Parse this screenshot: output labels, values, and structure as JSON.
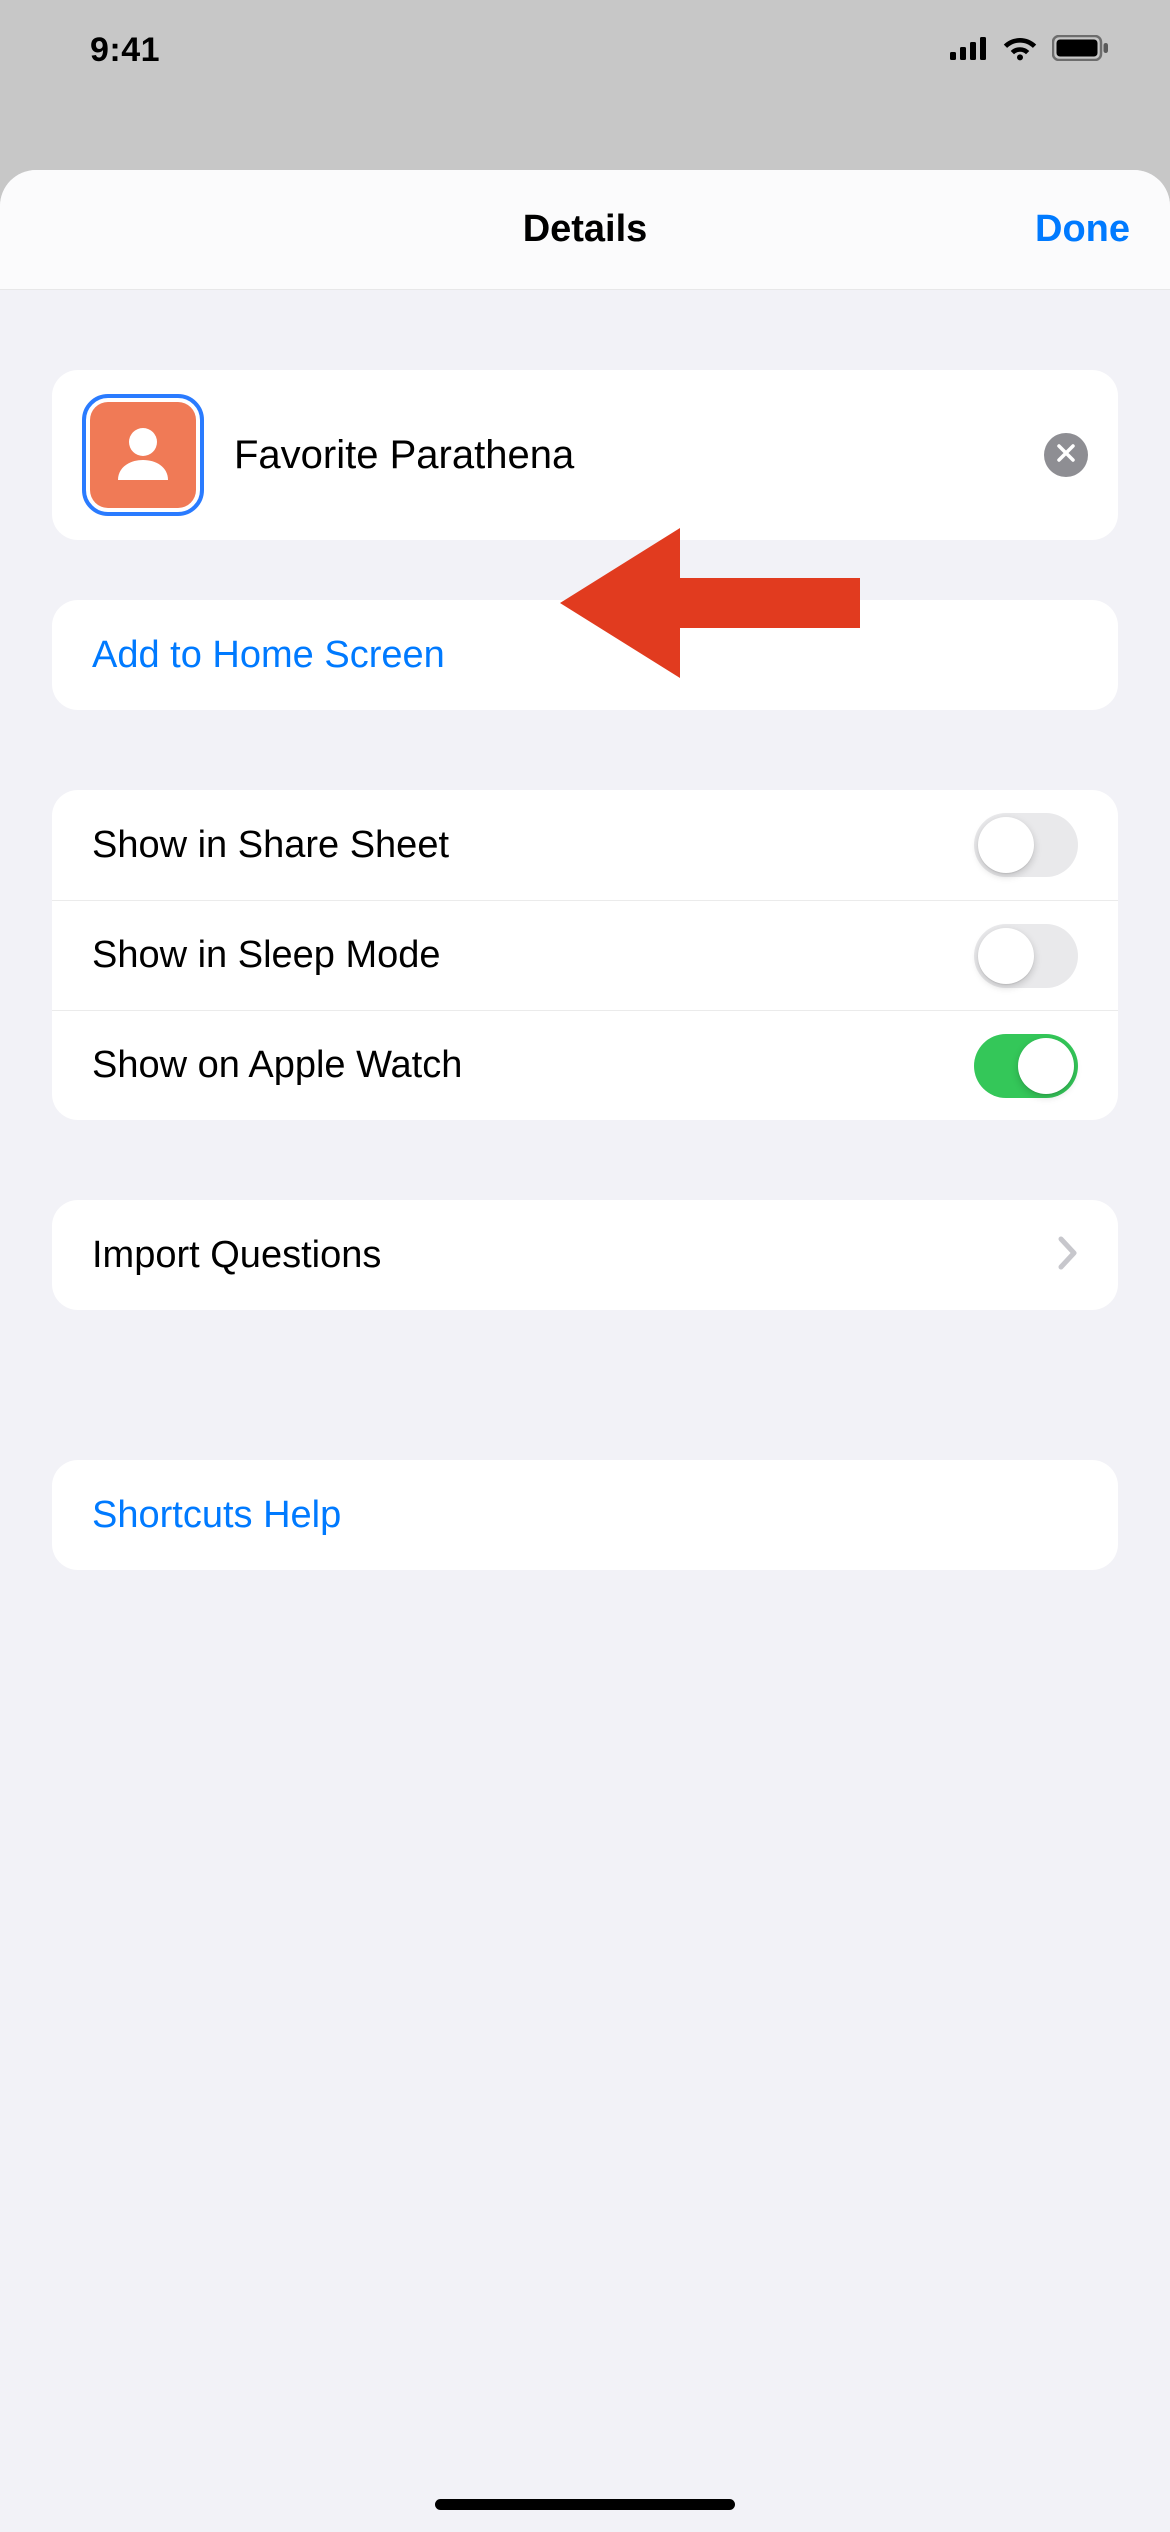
{
  "status": {
    "time": "9:41"
  },
  "nav": {
    "title": "Details",
    "done": "Done"
  },
  "shortcut": {
    "name": "Favorite Parathena"
  },
  "actions": {
    "add_home": "Add to Home Screen"
  },
  "toggles": {
    "share_sheet": {
      "label": "Show in Share Sheet",
      "on": false
    },
    "sleep_mode": {
      "label": "Show in Sleep Mode",
      "on": false
    },
    "apple_watch": {
      "label": "Show on Apple Watch",
      "on": true
    }
  },
  "import_questions": "Import Questions",
  "help": "Shortcuts Help",
  "annotation": {
    "arrow_color": "#e13b1f"
  }
}
